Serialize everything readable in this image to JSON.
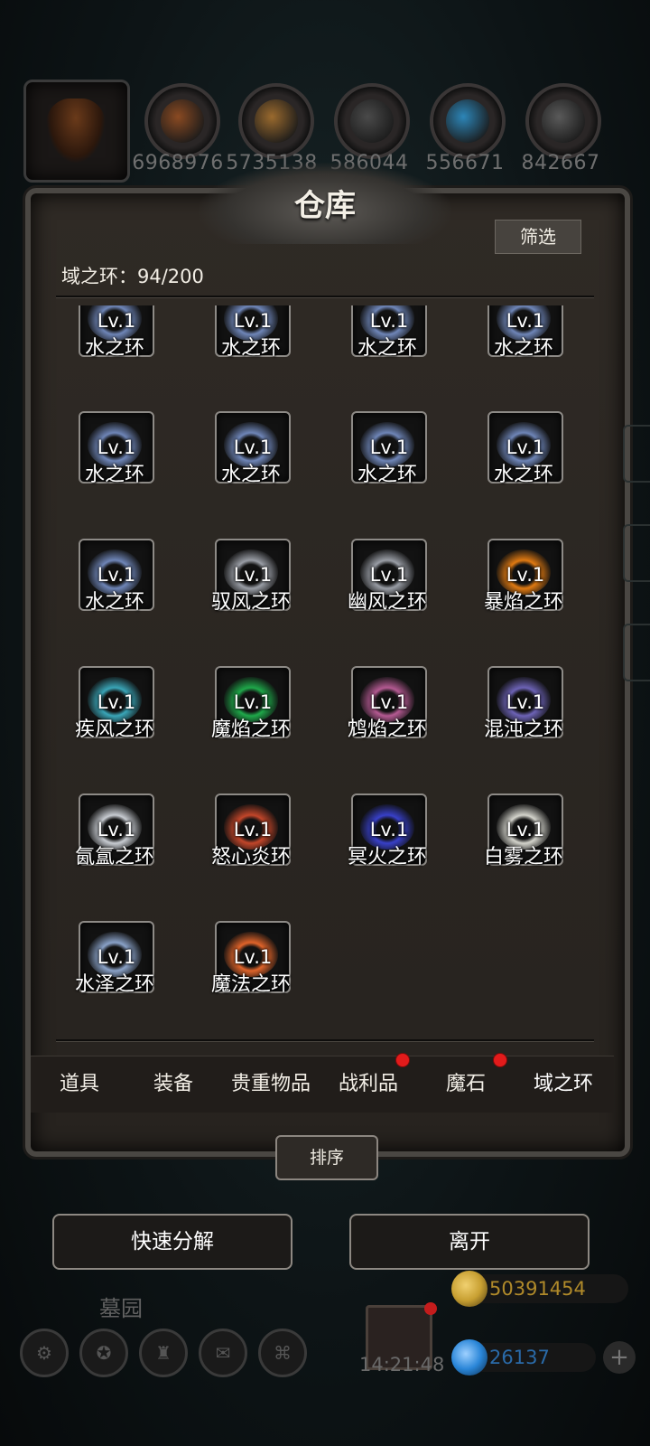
{
  "resources": [
    {
      "icon": "meat-icon",
      "value": "6968976",
      "color": "#8a4a22"
    },
    {
      "icon": "wood-icon",
      "value": "5735138",
      "color": "#9a6a2e"
    },
    {
      "icon": "stone-icon",
      "value": "586044",
      "color": "#4a4a4a"
    },
    {
      "icon": "crystal-icon",
      "value": "556671",
      "color": "#2d86b8"
    },
    {
      "icon": "iron-icon",
      "value": "842667",
      "color": "#5a5a5a"
    }
  ],
  "panel": {
    "title": "仓库",
    "filter_label": "筛选",
    "count_label": "域之环：94/200"
  },
  "items": [
    {
      "name": "水之环",
      "level": "Lv.1",
      "color": "#6f86b8"
    },
    {
      "name": "水之环",
      "level": "Lv.1",
      "color": "#6f86b8"
    },
    {
      "name": "水之环",
      "level": "Lv.1",
      "color": "#6f86b8"
    },
    {
      "name": "水之环",
      "level": "Lv.1",
      "color": "#6f86b8"
    },
    {
      "name": "水之环",
      "level": "Lv.1",
      "color": "#6f86b8"
    },
    {
      "name": "水之环",
      "level": "Lv.1",
      "color": "#6f86b8"
    },
    {
      "name": "水之环",
      "level": "Lv.1",
      "color": "#6f86b8"
    },
    {
      "name": "水之环",
      "level": "Lv.1",
      "color": "#6f86b8"
    },
    {
      "name": "水之环",
      "level": "Lv.1",
      "color": "#6f86b8"
    },
    {
      "name": "驭风之环",
      "level": "Lv.1",
      "color": "#9a9ea6"
    },
    {
      "name": "幽风之环",
      "level": "Lv.1",
      "color": "#9a9ea6"
    },
    {
      "name": "暴焰之环",
      "level": "Lv.1",
      "color": "#e07a12"
    },
    {
      "name": "疾风之环",
      "level": "Lv.1",
      "color": "#3aa6b8"
    },
    {
      "name": "魔焰之环",
      "level": "Lv.1",
      "color": "#1fa84a"
    },
    {
      "name": "鸩焰之环",
      "level": "Lv.1",
      "color": "#b45a92"
    },
    {
      "name": "混沌之环",
      "level": "Lv.1",
      "color": "#6d63b6"
    },
    {
      "name": "氤氲之环",
      "level": "Lv.1",
      "color": "#c8ccd2"
    },
    {
      "name": "怒心炎环",
      "level": "Lv.1",
      "color": "#c2462a"
    },
    {
      "name": "冥火之环",
      "level": "Lv.1",
      "color": "#3840c8"
    },
    {
      "name": "白雾之环",
      "level": "Lv.1",
      "color": "#d4d4cc"
    },
    {
      "name": "水泽之环",
      "level": "Lv.1",
      "color": "#8aa2c8"
    },
    {
      "name": "魔法之环",
      "level": "Lv.1",
      "color": "#e0642a"
    }
  ],
  "tabs": [
    {
      "label": "道具",
      "badge": false,
      "active": false
    },
    {
      "label": "装备",
      "badge": false,
      "active": false
    },
    {
      "label": "贵重物品",
      "badge": false,
      "active": false
    },
    {
      "label": "战利品",
      "badge": true,
      "active": false
    },
    {
      "label": "魔石",
      "badge": true,
      "active": false
    },
    {
      "label": "域之环",
      "badge": false,
      "active": true
    }
  ],
  "buttons": {
    "sort": "排序",
    "quick_decompose": "快速分解",
    "leave": "离开"
  },
  "hud": {
    "location": "墓园",
    "clock": "14:21:48",
    "gold": "50391454",
    "gems": "26137",
    "gold_color": "#c8a032",
    "gem_color": "#2a86d8"
  }
}
